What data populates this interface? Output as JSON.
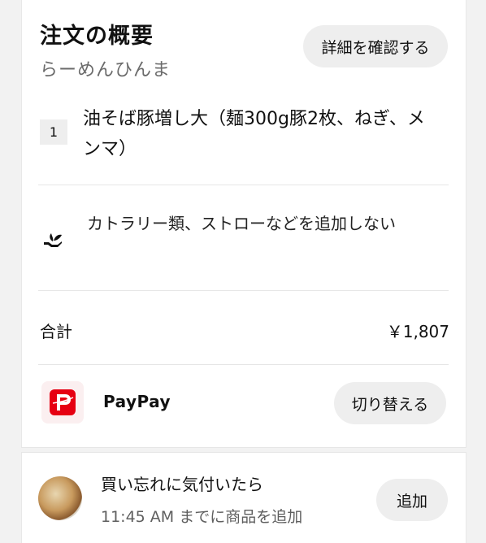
{
  "order": {
    "title": "注文の概要",
    "restaurant": "らーめんひんま",
    "details_label": "詳細を確認する"
  },
  "item": {
    "quantity": "1",
    "name": "油そば豚増し大（麺300g豚2枚、ねぎ、メンマ）"
  },
  "cutlery": {
    "icon": "cutlery-plant-icon",
    "text": "カトラリー類、ストローなどを追加しない"
  },
  "total": {
    "label": "合計",
    "value": "￥1,807"
  },
  "payment": {
    "method": "PayPay",
    "switch_label": "切り替える",
    "brand_color": "#e60012"
  },
  "addon": {
    "title": "買い忘れに気付いたら",
    "subtitle": "11:45 AM までに商品を追加",
    "add_label": "追加"
  }
}
